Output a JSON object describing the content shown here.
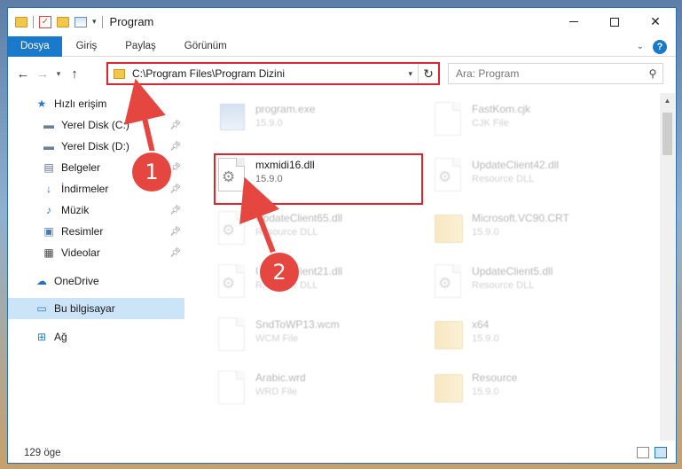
{
  "window": {
    "title": "Program",
    "controls": {
      "minimize": "–",
      "maximize": "☐",
      "close": "✕"
    }
  },
  "ribbon": {
    "tabs": [
      "Dosya",
      "Giriş",
      "Paylaş",
      "Görünüm"
    ],
    "active_tab": "Dosya",
    "help": "?"
  },
  "nav": {
    "back": "←",
    "forward": "→",
    "recent": "▾",
    "up": "↑",
    "address": "C:\\Program Files\\Program Dizini",
    "refresh": "↻"
  },
  "search": {
    "placeholder": "Ara: Program"
  },
  "sidebar": {
    "items": [
      {
        "label": "Hızlı erişim",
        "icon": "star-icon",
        "pinned": false
      },
      {
        "label": "Yerel Disk (C:)",
        "icon": "drive-icon",
        "pinned": true
      },
      {
        "label": "Yerel Disk (D:)",
        "icon": "drive-icon",
        "pinned": true
      },
      {
        "label": "Belgeler",
        "icon": "document-icon",
        "pinned": true
      },
      {
        "label": "İndirmeler",
        "icon": "download-icon",
        "pinned": true
      },
      {
        "label": "Müzik",
        "icon": "music-icon",
        "pinned": true
      },
      {
        "label": "Resimler",
        "icon": "picture-icon",
        "pinned": true
      },
      {
        "label": "Videolar",
        "icon": "video-icon",
        "pinned": true
      },
      {
        "label": "OneDrive",
        "icon": "cloud-icon",
        "pinned": false
      },
      {
        "label": "Bu bilgisayar",
        "icon": "computer-icon",
        "pinned": false,
        "selected": true
      },
      {
        "label": "Ağ",
        "icon": "network-icon",
        "pinned": false
      }
    ]
  },
  "files": [
    {
      "name": "program.exe",
      "sub": "15.9.0",
      "icon": "exe-icon",
      "faded": true
    },
    {
      "name": "FastKom.cjk",
      "sub": "CJK File",
      "icon": "file-icon",
      "faded": true
    },
    {
      "name": "mxmidi16.dll",
      "sub": "15.9.0",
      "icon": "dll-icon",
      "faded": false
    },
    {
      "name": "UpdateClient42.dll",
      "sub": "Resource DLL",
      "icon": "dll-icon",
      "faded": true
    },
    {
      "name": "UpdateClient65.dll",
      "sub": "Resource DLL",
      "icon": "dll-icon",
      "faded": true
    },
    {
      "name": "Microsoft.VC90.CRT",
      "sub": "15.9.0",
      "icon": "folder-icon",
      "faded": true
    },
    {
      "name": "UpdateClient21.dll",
      "sub": "Resource DLL",
      "icon": "dll-icon",
      "faded": true
    },
    {
      "name": "UpdateClient5.dll",
      "sub": "Resource DLL",
      "icon": "dll-icon",
      "faded": true
    },
    {
      "name": "SndToWP13.wcm",
      "sub": "WCM File",
      "icon": "file-icon",
      "faded": true
    },
    {
      "name": "x64",
      "sub": "15.9.0",
      "icon": "folder-icon",
      "faded": true
    },
    {
      "name": "Arabic.wrd",
      "sub": "WRD File",
      "icon": "file-icon",
      "faded": true
    },
    {
      "name": "Resource",
      "sub": "15.9.0",
      "icon": "folder-icon",
      "faded": true
    }
  ],
  "status": {
    "count": "129 öge"
  },
  "annotations": {
    "step1": "1",
    "step2": "2"
  },
  "colors": {
    "accent": "#1979ca",
    "highlight": "#e0242b",
    "badge": "#e5463f",
    "selected": "#cce4f7"
  }
}
